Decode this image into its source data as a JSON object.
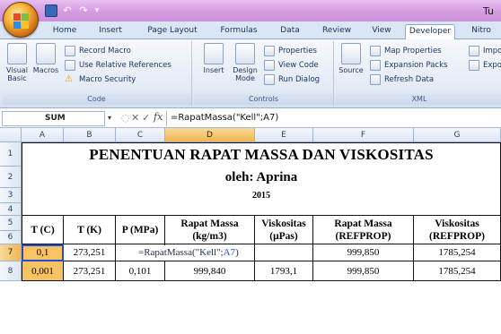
{
  "window": {
    "title": "Tu"
  },
  "tabs": [
    "Home",
    "Insert",
    "Page Layout",
    "Formulas",
    "Data",
    "Review",
    "View",
    "Developer",
    "Nitro"
  ],
  "active_tab": "Developer",
  "ribbon": {
    "code": {
      "label": "Code",
      "visual_basic": "Visual Basic",
      "macros": "Macros",
      "record_macro": "Record Macro",
      "use_relative": "Use Relative References",
      "macro_security": "Macro Security"
    },
    "controls": {
      "label": "Controls",
      "insert": "Insert",
      "design_mode": "Design Mode",
      "properties": "Properties",
      "view_code": "View Code",
      "run_dialog": "Run Dialog"
    },
    "xml": {
      "label": "XML",
      "source": "Source",
      "map_properties": "Map Properties",
      "expansion_packs": "Expansion Packs",
      "refresh_data": "Refresh Data",
      "import": "Impo",
      "export": "Expo"
    }
  },
  "formula_bar": {
    "name_box": "SUM",
    "formula": "=RapatMassa(\"Kell\";A7)"
  },
  "columns": [
    "A",
    "B",
    "C",
    "D",
    "E",
    "F",
    "G"
  ],
  "rows": [
    "1",
    "2",
    "3",
    "4",
    "5",
    "6",
    "7",
    "8"
  ],
  "sheet": {
    "title": "PENENTUAN RAPAT MASSA DAN VISKOSITAS",
    "author": "oleh: Aprina",
    "year": "2015",
    "headers": {
      "a": "T (C)",
      "b": "T (K)",
      "c": "P (MPa)",
      "d1": "Rapat Massa",
      "d2": "(kg/m3)",
      "e1": "Viskositas",
      "e2": "(μPas)",
      "f1": "Rapat Massa",
      "f2": "(REFPROP)",
      "g1": "Viskositas",
      "g2": "(REFPROP)"
    },
    "row7": {
      "a": "0,1",
      "b": "273,251",
      "edit_prefix": "=RapatMassa(\"Kell\";",
      "edit_ref": "A7",
      "edit_suffix": ")",
      "f": "999,850",
      "g": "1785,254"
    },
    "row8": {
      "a": "0,001",
      "b": "273,251",
      "c": "0,101",
      "d": "999,840",
      "e": "1793,1",
      "f": "999,850",
      "g": "1785,254"
    }
  },
  "colors": {
    "accent": "#f9c262",
    "ref": "#1e4fd8"
  }
}
